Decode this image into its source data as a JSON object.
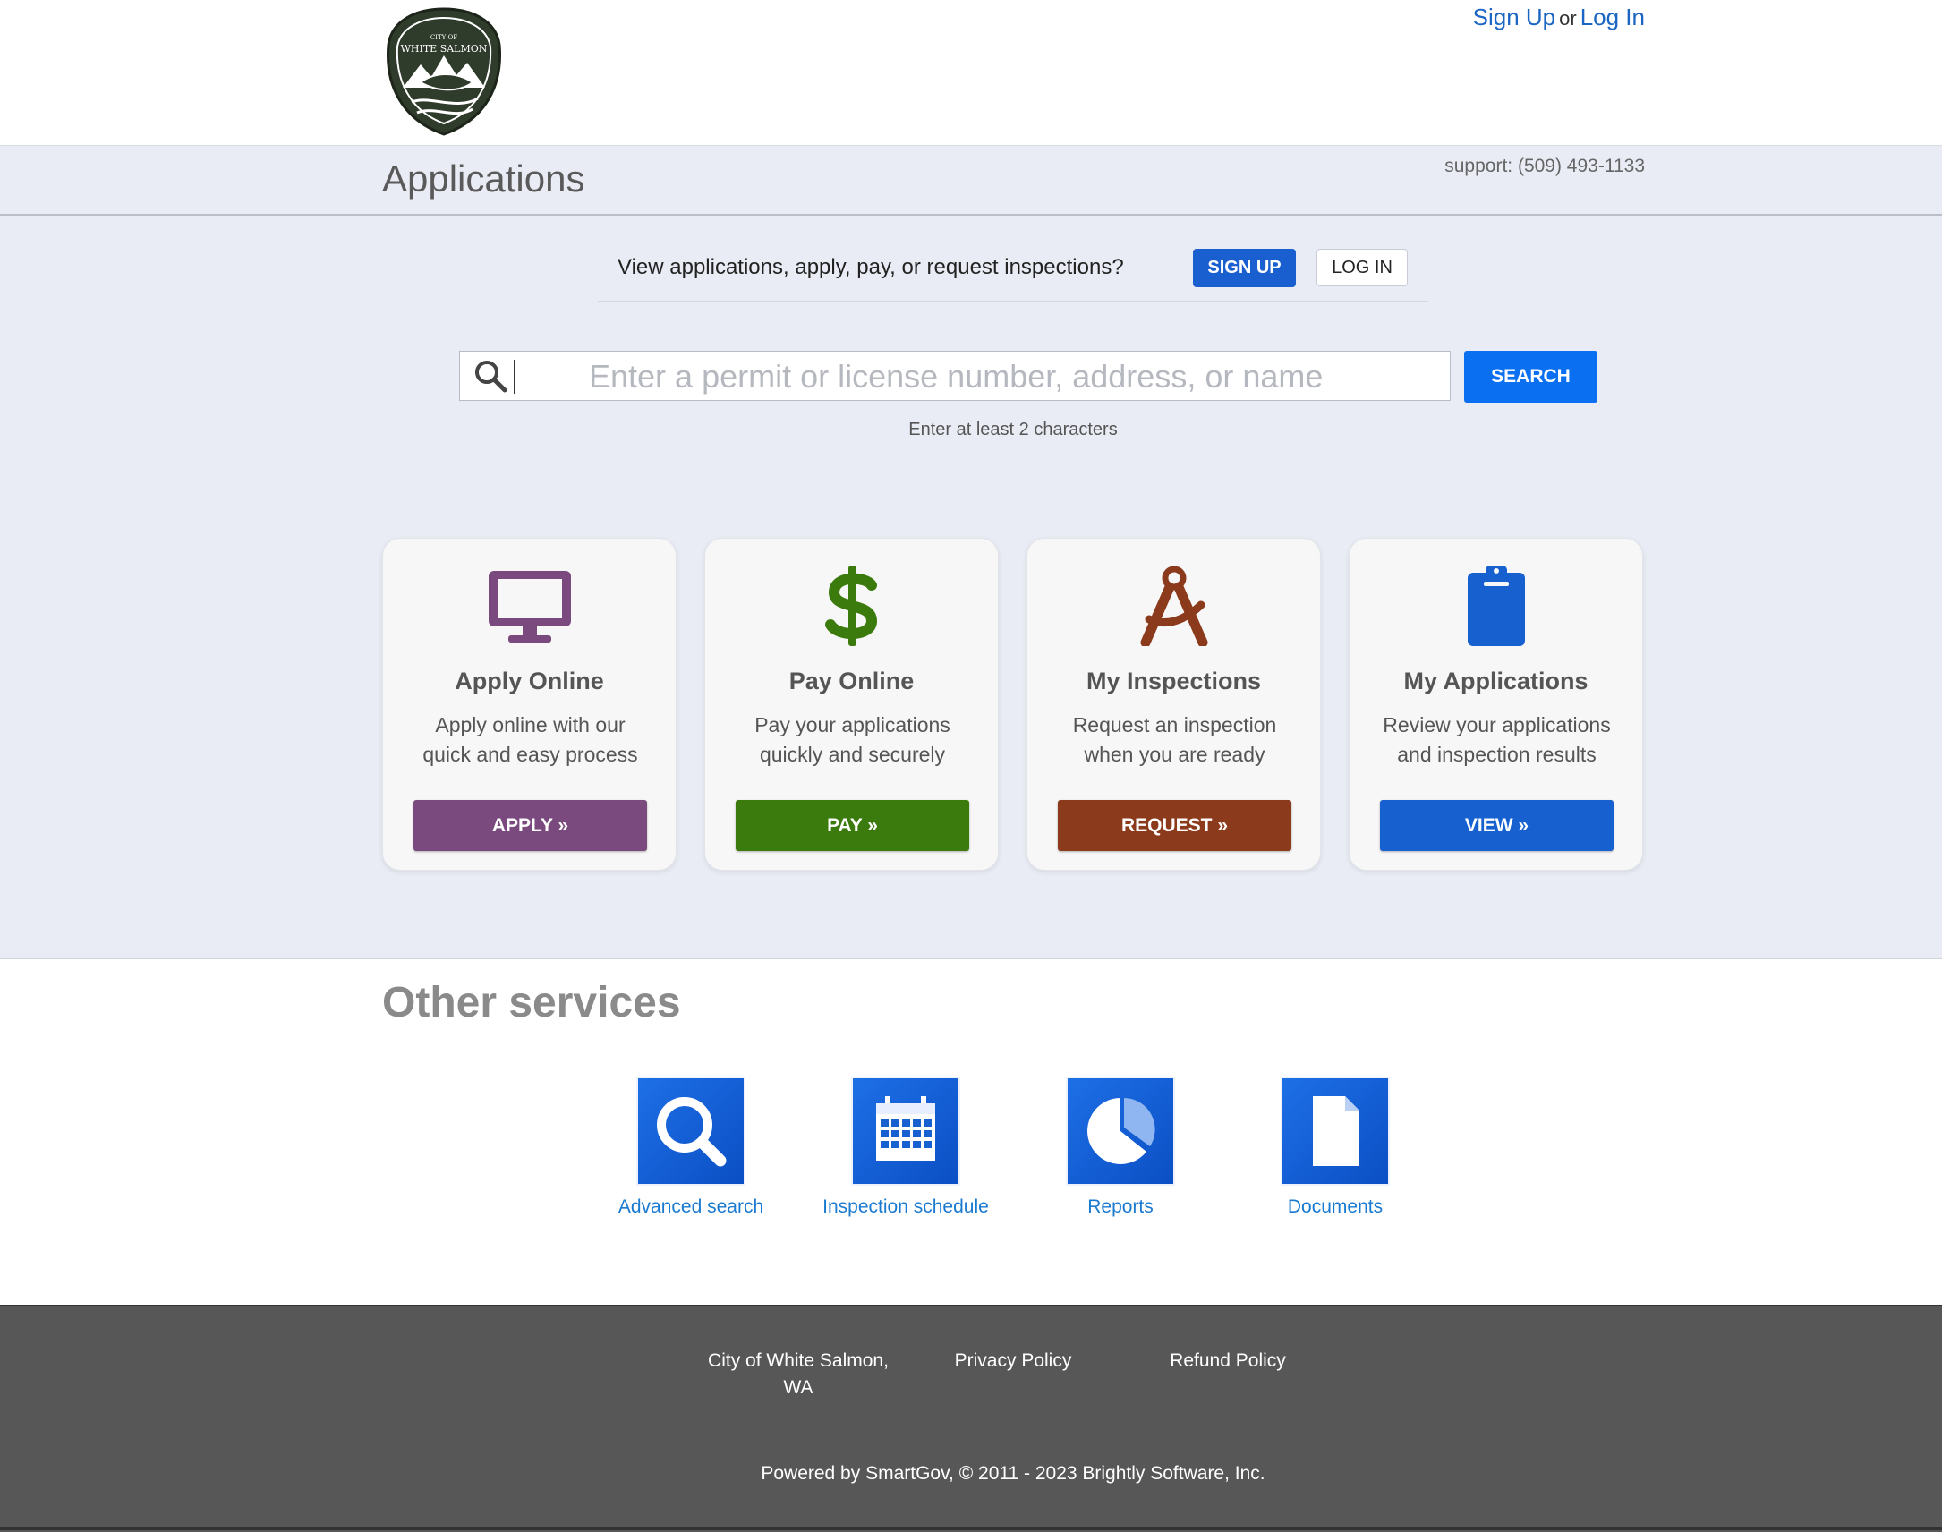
{
  "header": {
    "logo_alt": "City of White Salmon",
    "logo_text_top": "CITY OF",
    "logo_text_main": "WHITE SALMON",
    "sign_up_link": "Sign Up",
    "or_text": "or",
    "log_in_link": "Log In"
  },
  "titlebar": {
    "title": "Applications",
    "support": "support: (509) 493-1133"
  },
  "prompt": {
    "text": "View applications, apply, pay, or request inspections?",
    "sign_up_button": "SIGN UP",
    "log_in_button": "LOG IN"
  },
  "search": {
    "placeholder": "Enter a permit or license number, address, or name",
    "value": "",
    "button": "SEARCH",
    "hint": "Enter at least 2 characters"
  },
  "cards": [
    {
      "title": "Apply Online",
      "desc_line1": "Apply online with our",
      "desc_line2": "quick and easy process",
      "button": "APPLY »",
      "color": "#7a4a7e",
      "icon": "monitor-icon"
    },
    {
      "title": "Pay Online",
      "desc_line1": "Pay your applications",
      "desc_line2": "quickly and securely",
      "button": "PAY »",
      "color": "#3b7a0c",
      "icon": "dollar-icon"
    },
    {
      "title": "My Inspections",
      "desc_line1": "Request an inspection",
      "desc_line2": "when you are ready",
      "button": "REQUEST »",
      "color": "#8c3a1c",
      "icon": "compass-icon"
    },
    {
      "title": "My Applications",
      "desc_line1": "Review your applications",
      "desc_line2": "and inspection results",
      "button": "VIEW »",
      "color": "#1660d0",
      "icon": "clipboard-icon"
    }
  ],
  "other_services": {
    "title": "Other services",
    "items": [
      {
        "label": "Advanced search",
        "icon": "search-icon"
      },
      {
        "label": "Inspection schedule",
        "icon": "calendar-icon"
      },
      {
        "label": "Reports",
        "icon": "pie-chart-icon"
      },
      {
        "label": "Documents",
        "icon": "document-icon"
      }
    ]
  },
  "footer": {
    "city_line1": "City of White Salmon,",
    "city_line2": "WA",
    "privacy": "Privacy Policy",
    "refund": "Refund Policy",
    "powered": "Powered by SmartGov, © 2011 - 2023 Brightly Software, Inc."
  },
  "colors": {
    "link": "#1a66c2",
    "band_bg": "#e9ecf4",
    "search_button": "#0a6ff0",
    "footer_bg": "#575757"
  }
}
